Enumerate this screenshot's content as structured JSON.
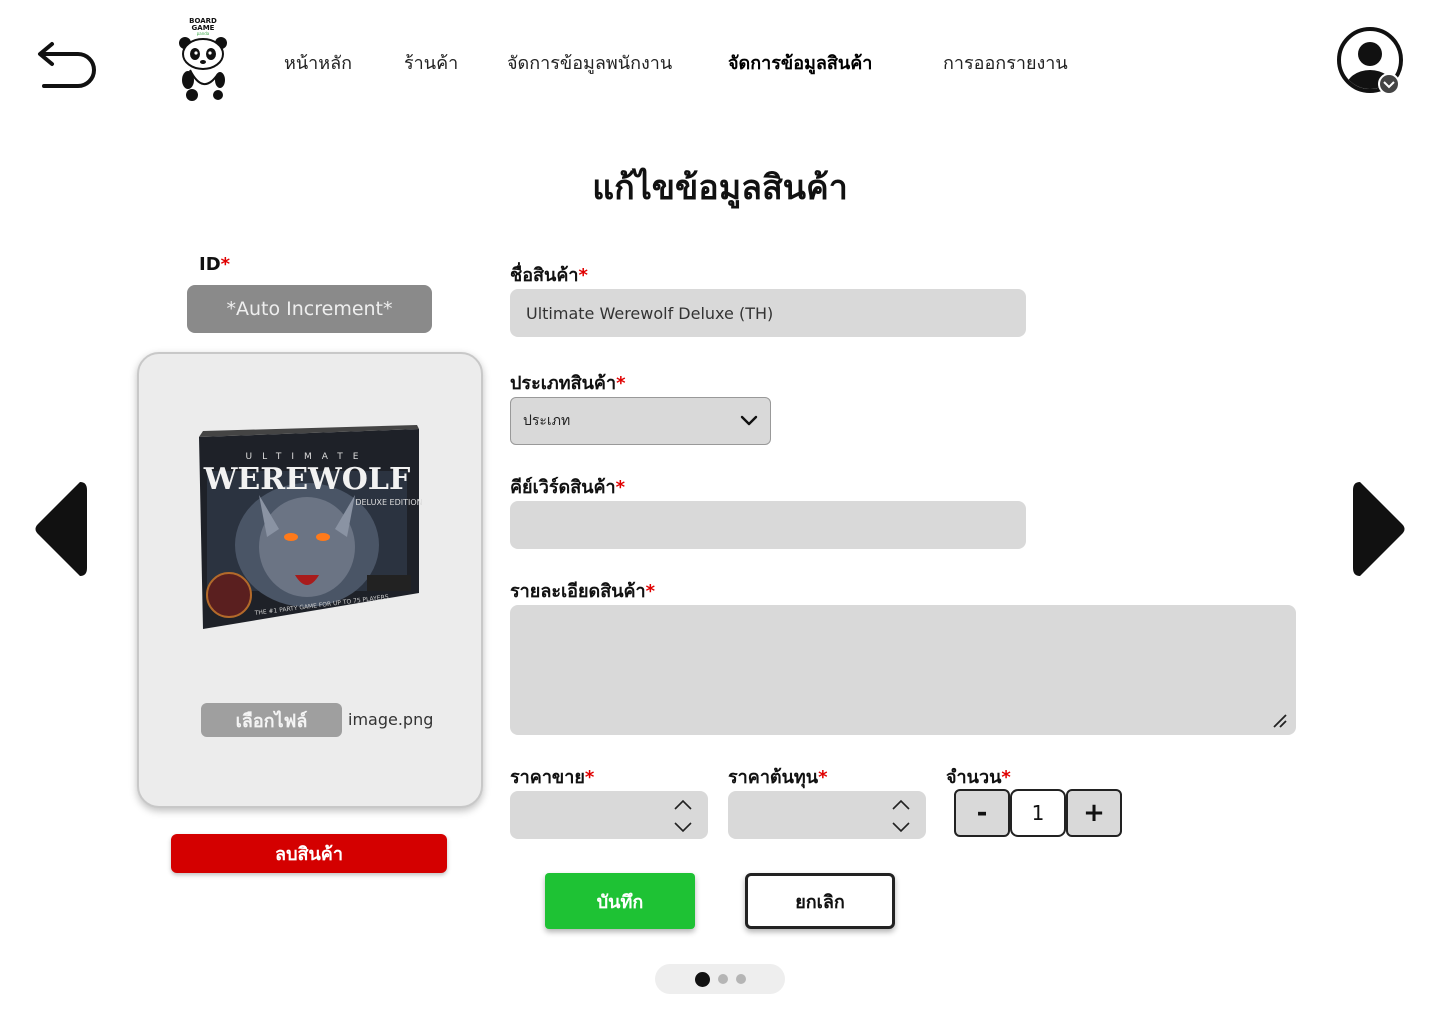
{
  "header": {
    "nav": [
      {
        "label": "หน้าหลัก",
        "active": false
      },
      {
        "label": "ร้านค้า",
        "active": false
      },
      {
        "label": "จัดการข้อมูลพนักงาน",
        "active": false
      },
      {
        "label": "จัดการข้อมูลสินค้า",
        "active": true
      },
      {
        "label": "การออกรายงาน",
        "active": false
      }
    ],
    "logo_text": [
      "BOARD",
      "GAME",
      "panda"
    ],
    "icons": {
      "back": "back-arrow-icon",
      "profile": "user-profile-icon",
      "profile_menu": "chevron-down-icon"
    }
  },
  "page": {
    "title": "แก้ไขข้อมูลสินค้า"
  },
  "left": {
    "id_label": "ID",
    "id_value": "*Auto Increment*",
    "image": {
      "alt": "Ultimate Werewolf Deluxe Edition box art",
      "box_title": "WEREWOLF",
      "box_top": "ULTIMATE",
      "box_edition": "DELUXE EDITION"
    },
    "file_button": "เลือกไฟล์",
    "file_name": "image.png",
    "delete_button": "ลบสินค้า"
  },
  "form": {
    "name": {
      "label": "ชื่อสินค้า",
      "value": "Ultimate Werewolf Deluxe (TH)"
    },
    "category": {
      "label": "ประเภทสินค้า",
      "value": "ประเภท"
    },
    "keyword": {
      "label": "คีย์เวิร์ดสินค้า",
      "value": ""
    },
    "description": {
      "label": "รายละเอียดสินค้า",
      "value": ""
    },
    "sell_price": {
      "label": "ราคาขาย",
      "value": ""
    },
    "cost_price": {
      "label": "ราคาต้นทุน",
      "value": ""
    },
    "quantity": {
      "label": "จำนวน",
      "value": "1",
      "minus": "-",
      "plus": "+"
    },
    "required_mark": "*",
    "save_button": "บันทึก",
    "cancel_button": "ยกเลิก"
  },
  "pagination": {
    "pages": 3,
    "current": 1
  },
  "colors": {
    "accent_save": "#1ec234",
    "danger": "#d40000",
    "required": "#e00000",
    "field": "#d9d9d9"
  }
}
